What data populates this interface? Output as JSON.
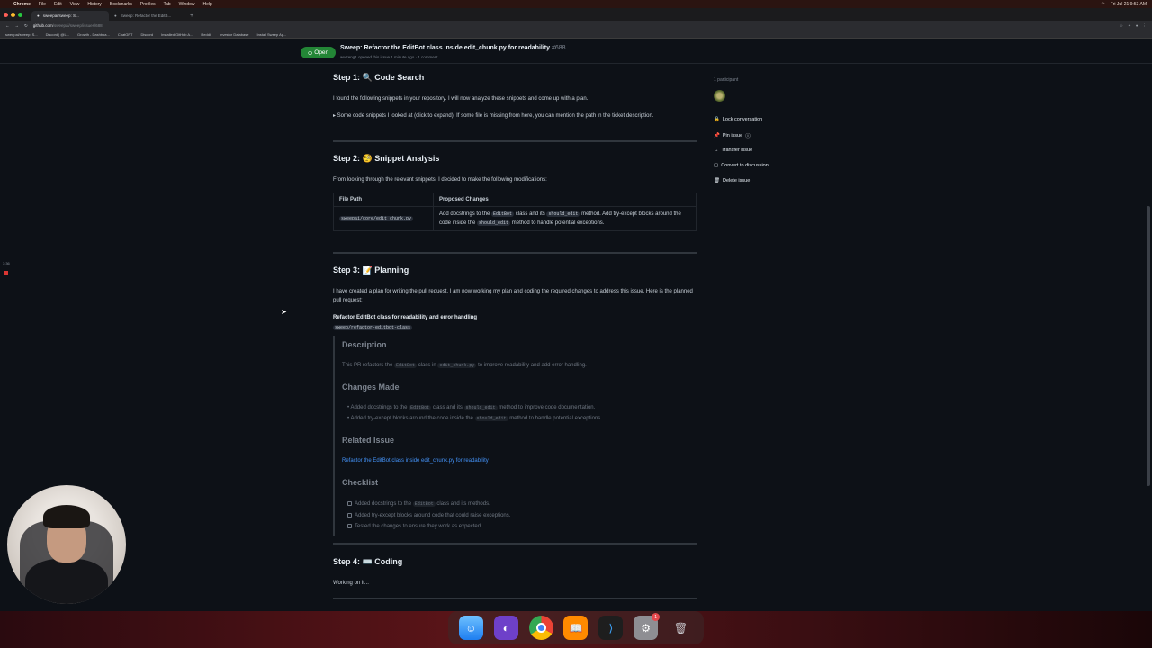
{
  "menubar": {
    "app": "Chrome",
    "items": [
      "File",
      "Edit",
      "View",
      "History",
      "Bookmarks",
      "Profiles",
      "Tab",
      "Window",
      "Help"
    ],
    "clock": "Fri Jul 21 9:53 AM"
  },
  "tabs": [
    {
      "label": "sweepai/sweep: S..."
    },
    {
      "label": "Sweep: Refactor the EditB..."
    }
  ],
  "url": {
    "host": "github.com",
    "path": "/sweepai/sweep/issues/688"
  },
  "bookmarks": [
    "sweepai/sweep: S...",
    "Discord | @L...",
    "Growth - Dashboa...",
    "ChatGPT",
    "Discord",
    "Installed GitHub A...",
    "Reddit",
    "Investor Database",
    "Install Sweep Ap..."
  ],
  "issue": {
    "status": "Open",
    "title": "Sweep: Refactor the EditBot class inside edit_chunk.py for readability",
    "number": "#688",
    "meta": "wwzeng1 opened this issue 1 minute ago · 1 comment"
  },
  "step1": {
    "title": "Step 1: 🔍 Code Search",
    "text": "I found the following snippets in your repository. I will now analyze these snippets and come up with a plan.",
    "details": "▸ Some code snippets I looked at (click to expand). If some file is missing from here, you can mention the path in the ticket description."
  },
  "step2": {
    "title": "Step 2: 🧐 Snippet Analysis",
    "text": "From looking through the relevant snippets, I decided to make the following modifications:",
    "col1": "File Path",
    "col2": "Proposed Changes",
    "file": "sweepai/core/edit_chunk.py",
    "change_a": "Add docstrings to the",
    "code_a": "EditBot",
    "change_b": "class and its",
    "code_b": "should_edit",
    "change_c": "method. Add try-except blocks around the code inside the",
    "code_c": "should_edit",
    "change_d": "method to handle potential exceptions."
  },
  "step3": {
    "title": "Step 3: 📝 Planning",
    "text": "I have created a plan for writing the pull request. I am now working my plan and coding the required changes to address this issue. Here is the planned pull request:",
    "pr_title": "Refactor EditBot class for readability and error handling",
    "branch": "sweep/refactor-editbot-class"
  },
  "pr": {
    "desc_h": "Description",
    "desc_a": "This PR refactors the",
    "desc_code1": "EditBot",
    "desc_b": "class in",
    "desc_code2": "edit_chunk.py",
    "desc_c": "to improve readability and add error handling.",
    "changes_h": "Changes Made",
    "ch1_a": "Added docstrings to the",
    "ch1_code1": "EditBot",
    "ch1_b": "class and its",
    "ch1_code2": "should_edit",
    "ch1_c": "method to improve code documentation.",
    "ch2_a": "Added try-except blocks around the code inside the",
    "ch2_code": "should_edit",
    "ch2_b": "method to handle potential exceptions.",
    "related_h": "Related Issue",
    "related_link": "Refactor the EditBot class inside edit_chunk.py for readability",
    "check_h": "Checklist",
    "cl1_a": "Added docstrings to the",
    "cl1_code": "EditBot",
    "cl1_b": "class and its methods.",
    "cl2": "Added try-except blocks around code that could raise exceptions.",
    "cl3": "Tested the changes to ensure they work as expected."
  },
  "step4": {
    "title": "Step 4: ⌨️ Coding",
    "text": "Working on it..."
  },
  "sidebar": {
    "participants": "1 participant",
    "lock": "Lock conversation",
    "pin": "Pin issue",
    "transfer": "Transfer issue",
    "convert": "Convert to discussion",
    "delete": "Delete issue"
  },
  "recording": {
    "label": "3:36"
  },
  "dock": [
    {
      "icon": "finder-icon"
    },
    {
      "icon": "github-desktop-icon"
    },
    {
      "icon": "chrome-icon"
    },
    {
      "icon": "books-icon"
    },
    {
      "icon": "vscode-icon"
    },
    {
      "icon": "system-settings-icon",
      "badge": "1"
    },
    {
      "icon": "trash-icon"
    }
  ]
}
